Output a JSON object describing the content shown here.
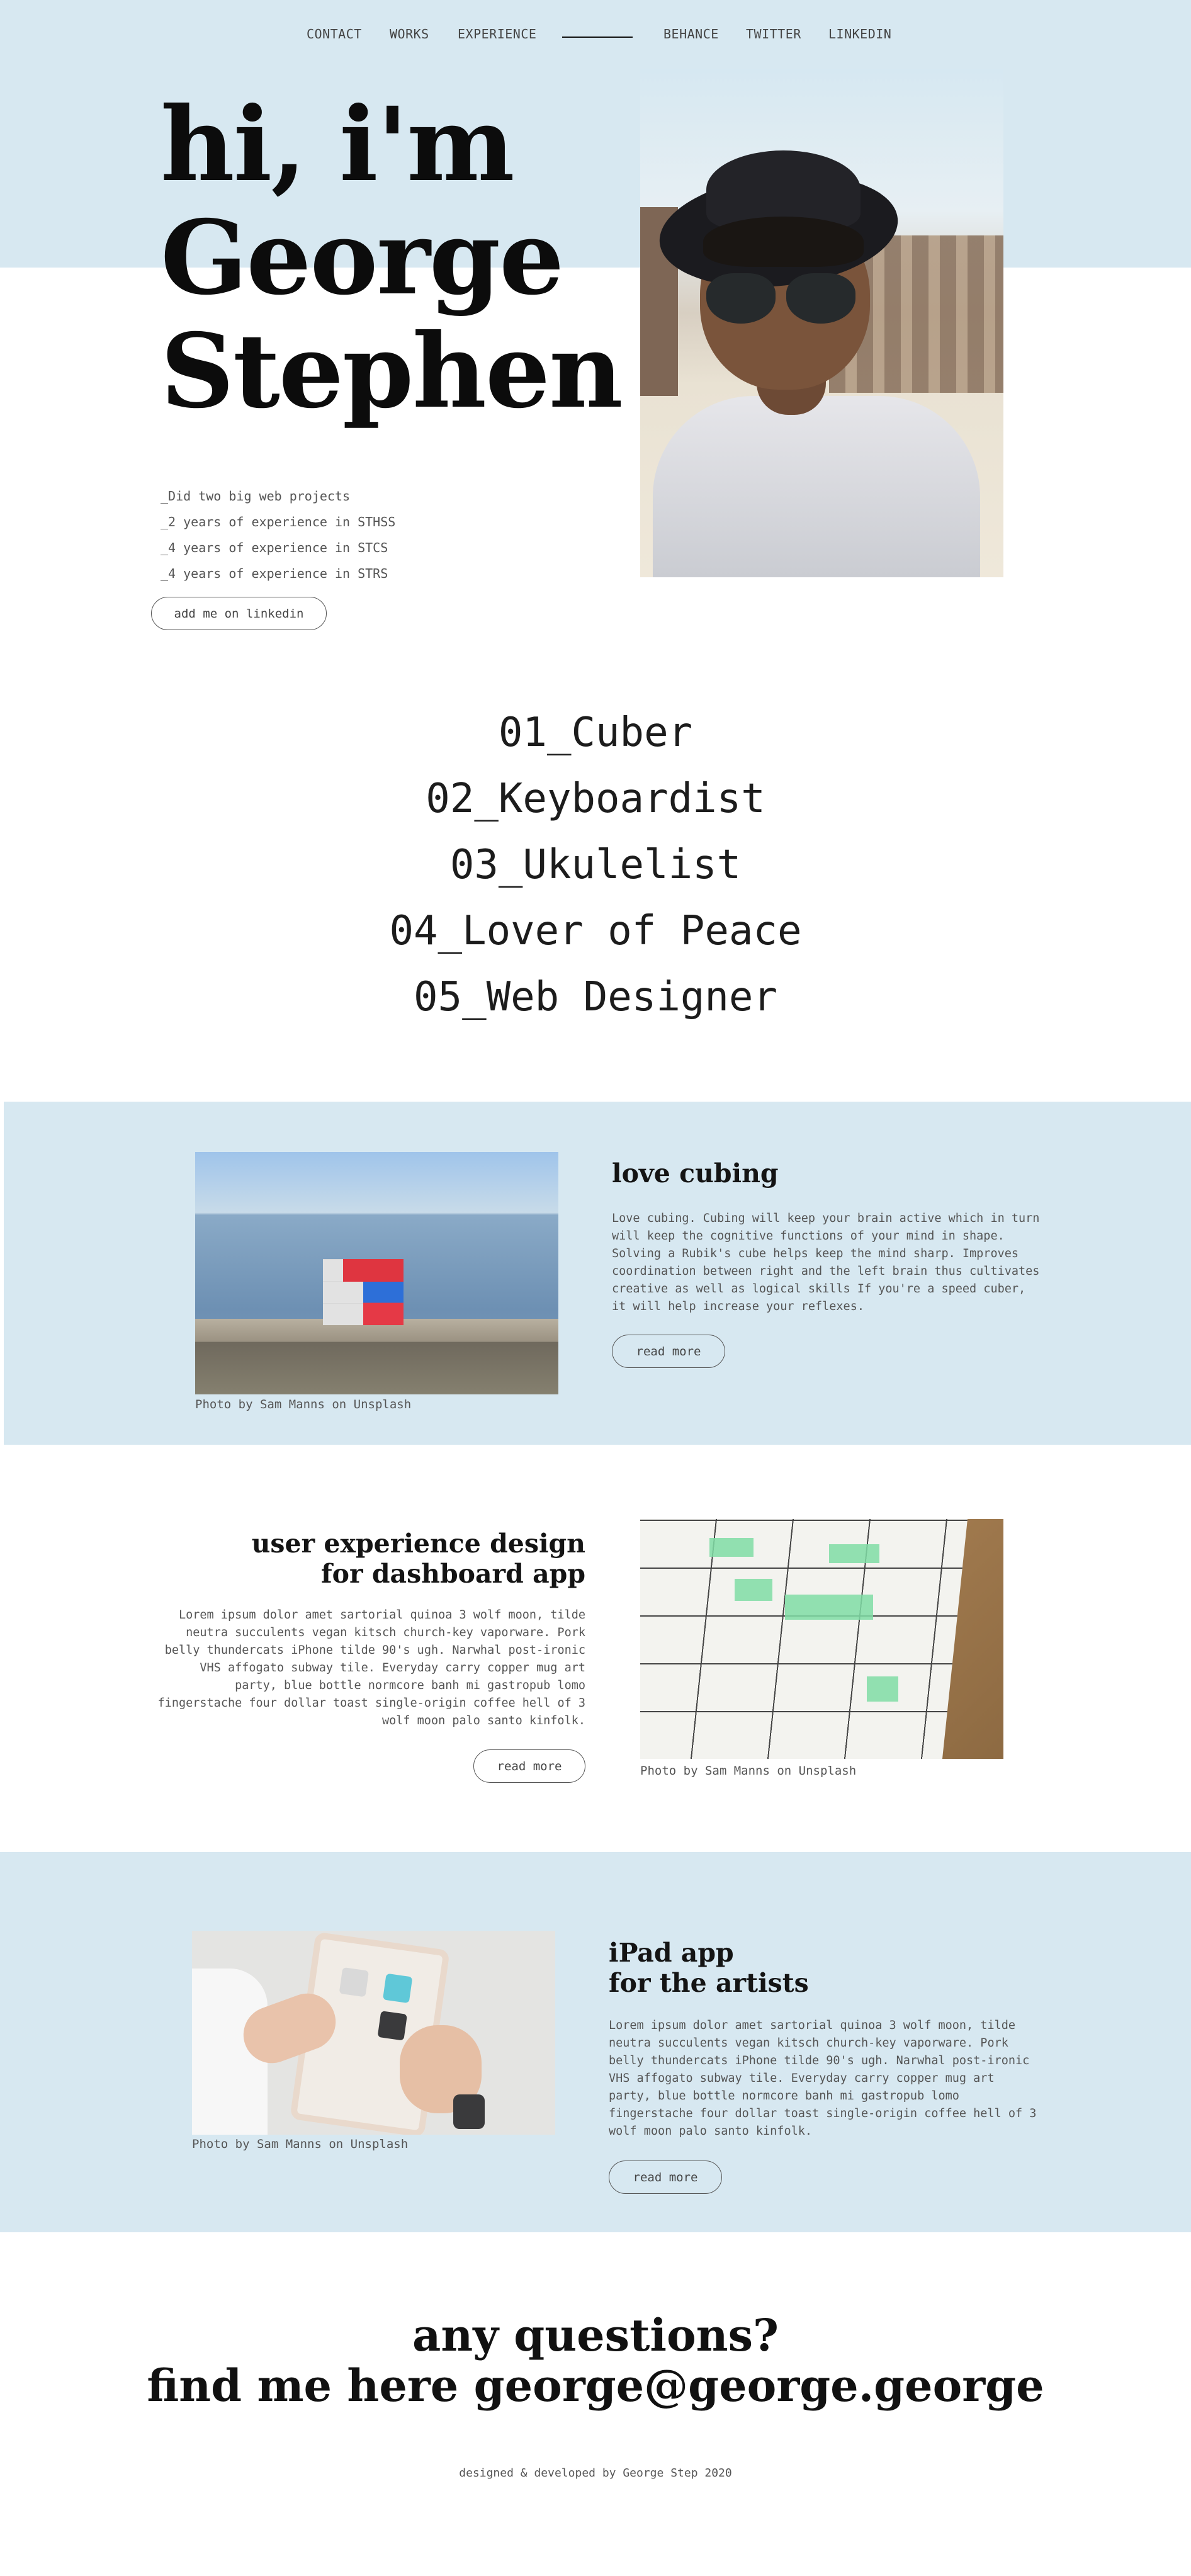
{
  "nav": {
    "left": [
      "CONTACT",
      "WORKS",
      "EXPERIENCE"
    ],
    "right": [
      "BEHANCE",
      "TWITTER",
      "LINKEDIN"
    ]
  },
  "hero": {
    "title_lines": [
      "hi, i'm",
      "George",
      "Stephen"
    ],
    "facts": [
      "_Did two big web projects",
      "_2 years of experience in STHSS",
      "_4 years of experience in STCS",
      "_4 years of experience in STRS"
    ],
    "linkedin_button": "add me on linkedin"
  },
  "roles": [
    "01_Cuber",
    "02_Keyboardist",
    "03_Ukulelist",
    "04_Lover of Peace",
    "05_Web Designer"
  ],
  "cubing": {
    "caption": "Photo by Sam Manns on Unsplash",
    "title": "love cubing",
    "body": "Love cubing. Cubing will keep your brain active which in turn will keep the cognitive functions of your mind in shape. Solving a Rubik's cube helps keep the mind sharp. Improves coordination between right and the left brain thus cultivates creative as well as logical skills If you're a speed cuber, it will help increase your reflexes.",
    "button": "read more"
  },
  "ux": {
    "title_lines": [
      "user experience design",
      "for dashboard app"
    ],
    "body": "Lorem ipsum dolor amet sartorial quinoa 3 wolf moon, tilde neutra succulents vegan kitsch church-key vaporware. Pork belly thundercats iPhone tilde 90's ugh. Narwhal post-ironic VHS affogato subway tile. Everyday carry copper mug art party, blue bottle normcore banh mi gastropub lomo fingerstache four dollar toast single-origin coffee hell of 3 wolf moon palo santo kinfolk.",
    "button": "read more",
    "caption": "Photo by Sam Manns on Unsplash"
  },
  "ipad": {
    "caption": "Photo by Sam Manns on Unsplash",
    "title_lines": [
      "iPad app",
      "for the artists"
    ],
    "body": "Lorem ipsum dolor amet sartorial quinoa 3 wolf moon, tilde neutra succulents vegan kitsch church-key vaporware. Pork belly thundercats iPhone tilde 90's ugh. Narwhal post-ironic VHS affogato subway tile. Everyday carry copper mug art party, blue bottle normcore banh mi gastropub lomo fingerstache four dollar toast single-origin coffee hell of 3 wolf moon palo santo kinfolk.",
    "button": "read more"
  },
  "contact": {
    "lines": [
      "any questions?",
      "find me here george@george.george"
    ]
  },
  "footer": {
    "note": "designed & developed by George Step 2020"
  },
  "colors": {
    "band": "#d7e8f1",
    "text": "#111111",
    "muted": "#555555"
  }
}
